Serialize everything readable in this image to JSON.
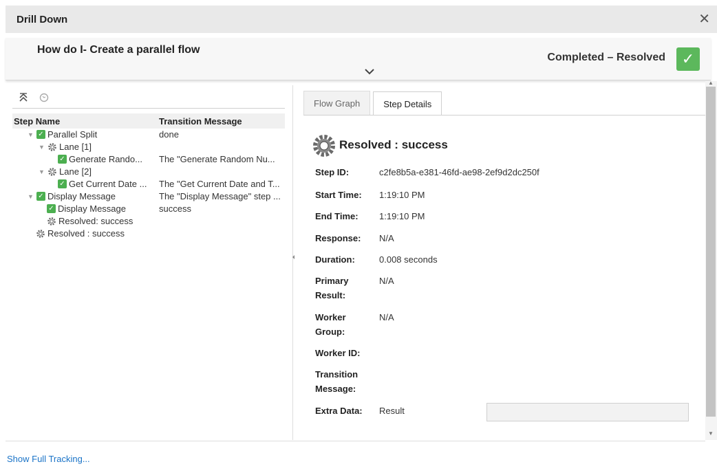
{
  "dialog": {
    "title": "Drill Down",
    "close_glyph": "✕"
  },
  "header": {
    "flow_name": "How do I- Create a parallel flow",
    "status": "Completed – Resolved",
    "status_color": "#5cb85c"
  },
  "tree": {
    "columns": [
      "Step Name",
      "Transition Message"
    ],
    "rows": [
      {
        "name": "Parallel Split",
        "message": "done",
        "icon": "check-icon"
      },
      {
        "name": "Lane [1]",
        "message": "",
        "icon": "gear-icon"
      },
      {
        "name": "Generate Rando...",
        "message": "The \"Generate Random Nu...",
        "icon": "check-icon"
      },
      {
        "name": "Lane [2]",
        "message": "",
        "icon": "gear-icon"
      },
      {
        "name": "Get Current Date ...",
        "message": "The \"Get Current Date and T...",
        "icon": "check-icon"
      },
      {
        "name": "Display Message",
        "message": "The \"Display Message\" step ...",
        "icon": "check-icon"
      },
      {
        "name": "Display Message",
        "message": "success",
        "icon": "check-icon"
      },
      {
        "name": "Resolved: success",
        "message": "",
        "icon": "gear-icon"
      },
      {
        "name": "Resolved : success",
        "message": "",
        "icon": "gear-icon"
      }
    ]
  },
  "tabs": [
    "Flow Graph",
    "Step Details"
  ],
  "details": {
    "title": "Resolved : success",
    "step_id_label": "Step ID:",
    "step_id": "c2fe8b5a-e381-46fd-ae98-2ef9d2dc250f",
    "start_label": "Start Time:",
    "start": "1:19:10 PM",
    "end_label": "End Time:",
    "end": "1:19:10 PM",
    "response_label": "Response:",
    "response": "N/A",
    "duration_label": "Duration:",
    "duration": "0.008 seconds",
    "primary_label_1": "Primary",
    "primary_label_2": "Result:",
    "primary": "N/A",
    "worker_label_1": "Worker",
    "worker_label_2": "Group:",
    "worker_group": "N/A",
    "worker_id_label": "Worker ID:",
    "transition_label_1": "Transition",
    "transition_label_2": "Message:",
    "extra_label": "Extra Data:",
    "extra_key": "Result"
  },
  "footer": {
    "link": "Show Full Tracking..."
  }
}
